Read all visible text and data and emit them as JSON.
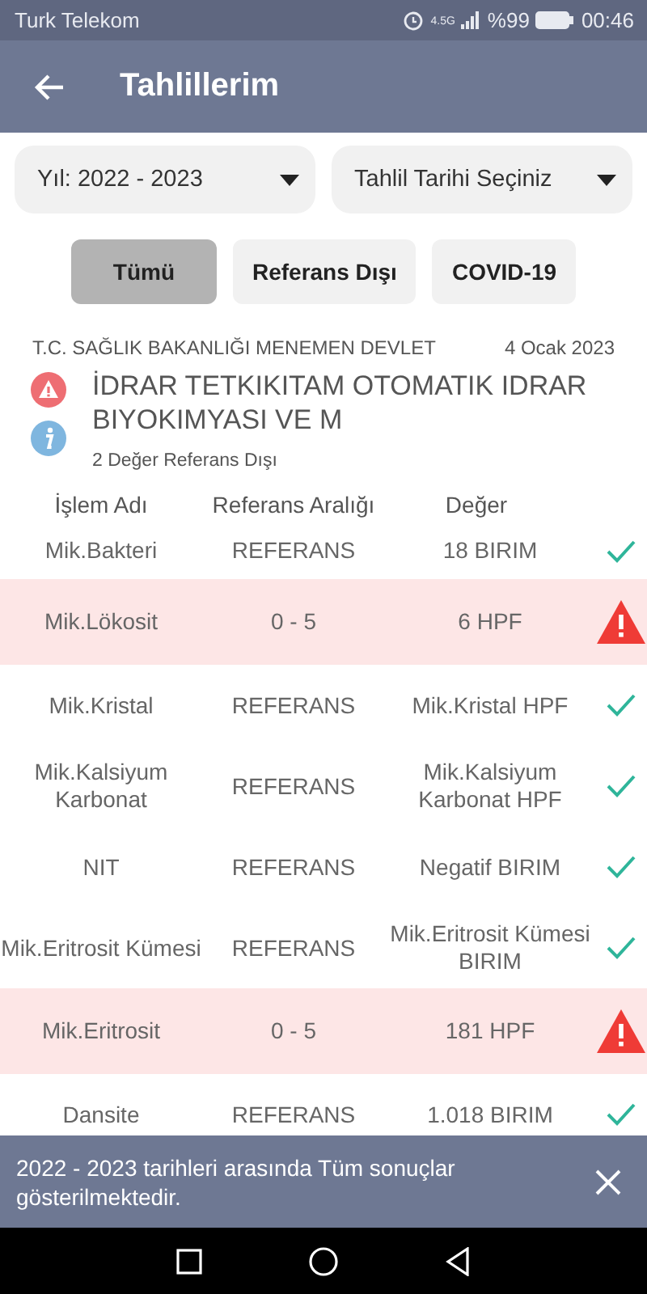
{
  "status_bar": {
    "carrier": "Turk Telekom",
    "network": "4.5G",
    "battery": "%99",
    "time": "00:46"
  },
  "app_bar": {
    "title": "Tahlillerim"
  },
  "filters": [
    {
      "label": "Yıl: 2022 - 2023"
    },
    {
      "label": "Tahlil Tarihi Seçiniz"
    }
  ],
  "chips": [
    {
      "label": "Tümü",
      "selected": true
    },
    {
      "label": "Referans Dışı",
      "selected": false
    },
    {
      "label": "COVID-19",
      "selected": false
    }
  ],
  "result": {
    "hospital": "T.C. SAĞLIK BAKANLIĞI MENEMEN DEVLET",
    "date": "4 Ocak 2023",
    "title": "İDRAR TETKIKITAM OTOMATIK IDRAR BIYOKIMYASI VE M",
    "summary": "2 Değer Referans Dışı"
  },
  "table": {
    "columns": [
      "İşlem Adı",
      "Referans Aralığı",
      "Değer"
    ],
    "rows": [
      {
        "name": "Mik.Bakteri",
        "range": "REFERANS",
        "value": "18 BIRIM",
        "kind": "ok"
      },
      {
        "name": "Mik.Lökosit",
        "range": "0 - 5",
        "value": "6 HPF",
        "kind": "alert"
      },
      {
        "name": "Mik.Kristal",
        "range": "REFERANS",
        "value": "Mik.Kristal HPF",
        "kind": "ok"
      },
      {
        "name": "Mik.Kalsiyum Karbonat",
        "range": "REFERANS",
        "value": "Mik.Kalsiyum Karbonat HPF",
        "kind": "ok"
      },
      {
        "name": "NIT",
        "range": "REFERANS",
        "value": "Negatif BIRIM",
        "kind": "ok"
      },
      {
        "name": "Mik.Eritrosit Kümesi",
        "range": "REFERANS",
        "value": "Mik.Eritrosit Kümesi BIRIM",
        "kind": "ok"
      },
      {
        "name": "Mik.Eritrosit",
        "range": "0 - 5",
        "value": "181 HPF",
        "kind": "alert"
      },
      {
        "name": "Dansite",
        "range": "REFERANS",
        "value": "1.018 BIRIM",
        "kind": "ok"
      }
    ]
  },
  "snackbar": {
    "message": "2022 - 2023 tarihleri arasında Tüm sonuçlar gösterilmektedir."
  }
}
